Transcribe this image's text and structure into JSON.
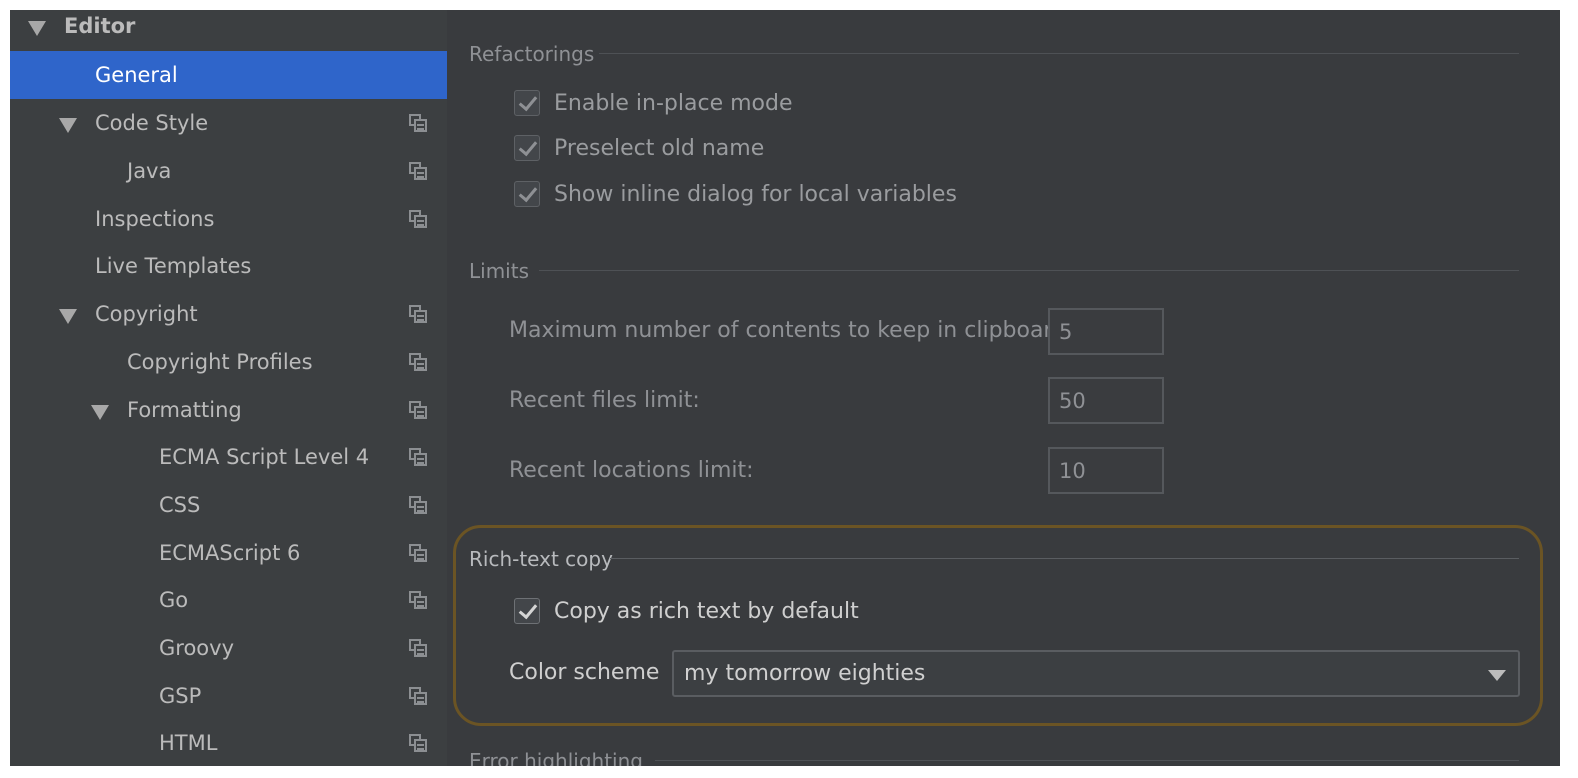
{
  "sidebar": {
    "items": [
      {
        "label": "Editor"
      },
      {
        "label": "General"
      },
      {
        "label": "Code Style"
      },
      {
        "label": "Java"
      },
      {
        "label": "Inspections"
      },
      {
        "label": "Live Templates"
      },
      {
        "label": "Copyright"
      },
      {
        "label": "Copyright Profiles"
      },
      {
        "label": "Formatting"
      },
      {
        "label": "ECMA Script Level 4"
      },
      {
        "label": "CSS"
      },
      {
        "label": "ECMAScript 6"
      },
      {
        "label": "Go"
      },
      {
        "label": "Groovy"
      },
      {
        "label": "GSP"
      },
      {
        "label": "HTML"
      }
    ]
  },
  "main": {
    "refactorings": {
      "title": "Refactorings",
      "options": [
        {
          "label": "Enable in-place mode",
          "checked": true
        },
        {
          "label": "Preselect old name",
          "checked": true
        },
        {
          "label": "Show inline dialog for local variables",
          "checked": true
        }
      ]
    },
    "limits": {
      "title": "Limits",
      "fields": [
        {
          "label": "Maximum number of contents to keep in clipboard:",
          "value": "5"
        },
        {
          "label": "Recent files limit:",
          "value": "50"
        },
        {
          "label": "Recent locations limit:",
          "value": "10"
        }
      ]
    },
    "rich_text_copy": {
      "title": "Rich-text copy",
      "copy_option": {
        "label": "Copy as rich text by default",
        "checked": true
      },
      "color_scheme_label": "Color scheme",
      "color_scheme_value": "my tomorrow eighties"
    },
    "error_highlighting": {
      "title": "Error highlighting"
    }
  },
  "colors": {
    "selection": "#2f65ca",
    "highlight_border": "#6b5424"
  }
}
